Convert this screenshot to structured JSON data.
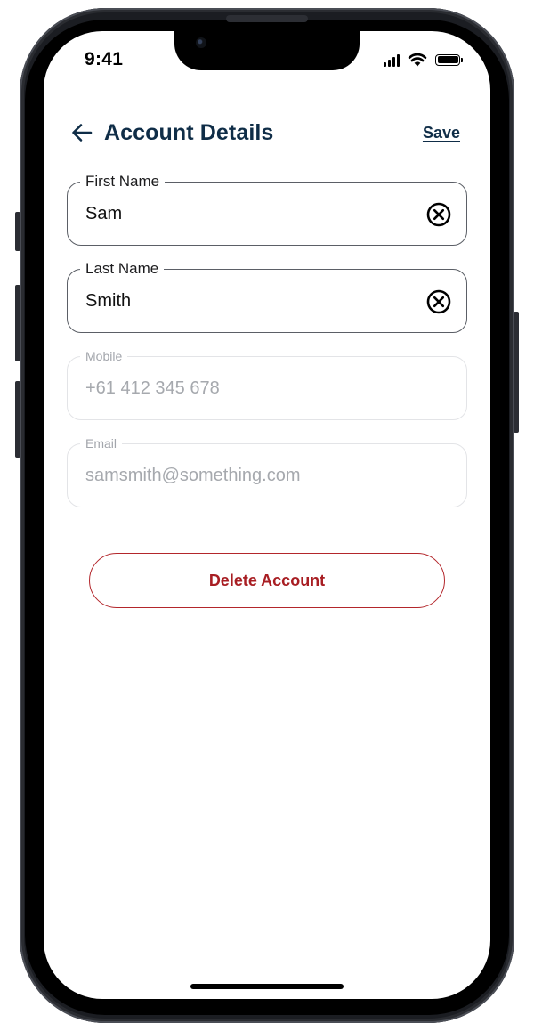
{
  "status_bar": {
    "time": "9:41",
    "icons": [
      "cellular-signal-icon",
      "wifi-icon",
      "battery-icon"
    ]
  },
  "header": {
    "back_icon": "arrow-left-icon",
    "title": "Account Details",
    "save_label": "Save"
  },
  "fields": {
    "first_name": {
      "label": "First Name",
      "value": "Sam",
      "clear_icon": "clear-circle-x-icon"
    },
    "last_name": {
      "label": "Last Name",
      "value": "Smith",
      "clear_icon": "clear-circle-x-icon"
    },
    "mobile": {
      "label": "Mobile",
      "value": "+61 412 345 678"
    },
    "email": {
      "label": "Email",
      "value": "samsmith@something.com"
    }
  },
  "actions": {
    "delete_label": "Delete Account"
  },
  "colors": {
    "primary_navy": "#0f2d47",
    "danger_red": "#a81e23",
    "field_border": "#5b5f66",
    "disabled_text": "#a6a9ae"
  }
}
